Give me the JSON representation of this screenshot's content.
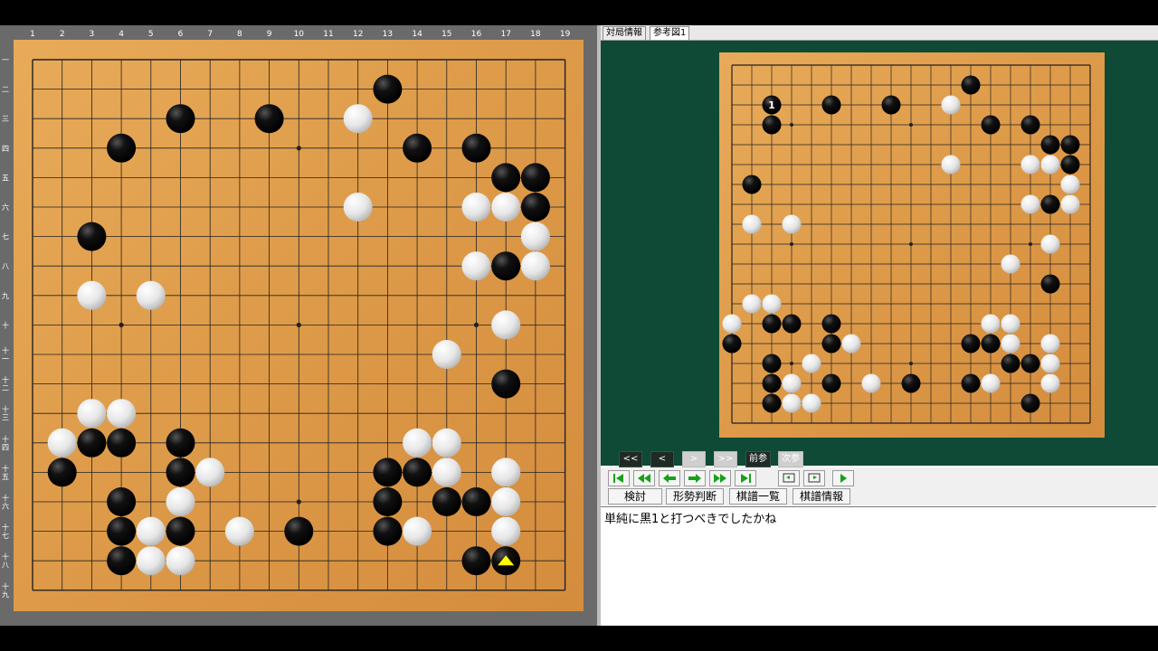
{
  "left_board": {
    "col_labels": [
      "1",
      "2",
      "3",
      "4",
      "5",
      "6",
      "7",
      "8",
      "9",
      "10",
      "11",
      "12",
      "13",
      "14",
      "15",
      "16",
      "17",
      "18",
      "19"
    ],
    "row_labels": [
      "一",
      "二",
      "三",
      "四",
      "五",
      "六",
      "七",
      "八",
      "九",
      "十",
      "十一",
      "十二",
      "十三",
      "十四",
      "十五",
      "十六",
      "十七",
      "十八",
      "十九"
    ],
    "black_stones": [
      [
        13,
        2
      ],
      [
        6,
        3
      ],
      [
        9,
        3
      ],
      [
        4,
        4
      ],
      [
        14,
        4
      ],
      [
        16,
        4
      ],
      [
        17,
        5
      ],
      [
        18,
        5
      ],
      [
        18,
        6
      ],
      [
        3,
        7
      ],
      [
        17,
        8
      ],
      [
        17,
        12
      ],
      [
        3,
        14
      ],
      [
        4,
        14
      ],
      [
        6,
        14
      ],
      [
        2,
        15
      ],
      [
        6,
        15
      ],
      [
        13,
        15
      ],
      [
        14,
        15
      ],
      [
        4,
        16
      ],
      [
        13,
        16
      ],
      [
        15,
        16
      ],
      [
        16,
        16
      ],
      [
        4,
        17
      ],
      [
        6,
        17
      ],
      [
        10,
        17
      ],
      [
        13,
        17
      ],
      [
        4,
        18
      ],
      [
        16,
        18
      ],
      [
        17,
        18
      ]
    ],
    "white_stones": [
      [
        12,
        3
      ],
      [
        12,
        6
      ],
      [
        16,
        6
      ],
      [
        17,
        6
      ],
      [
        18,
        7
      ],
      [
        16,
        8
      ],
      [
        18,
        8
      ],
      [
        3,
        9
      ],
      [
        5,
        9
      ],
      [
        17,
        10
      ],
      [
        15,
        11
      ],
      [
        3,
        13
      ],
      [
        4,
        13
      ],
      [
        2,
        14
      ],
      [
        14,
        14
      ],
      [
        15,
        14
      ],
      [
        7,
        15
      ],
      [
        15,
        15
      ],
      [
        17,
        15
      ],
      [
        6,
        16
      ],
      [
        17,
        16
      ],
      [
        5,
        17
      ],
      [
        8,
        17
      ],
      [
        14,
        17
      ],
      [
        17,
        17
      ],
      [
        5,
        18
      ],
      [
        6,
        18
      ]
    ],
    "last_move": [
      17,
      18
    ],
    "star_points": [
      [
        4,
        4
      ],
      [
        10,
        4
      ],
      [
        16,
        4
      ],
      [
        4,
        10
      ],
      [
        10,
        10
      ],
      [
        16,
        10
      ],
      [
        4,
        16
      ],
      [
        10,
        16
      ],
      [
        16,
        16
      ]
    ]
  },
  "right_board": {
    "black_stones": [
      [
        13,
        2
      ],
      [
        3,
        3
      ],
      [
        6,
        3
      ],
      [
        9,
        3
      ],
      [
        3,
        4
      ],
      [
        14,
        4
      ],
      [
        16,
        4
      ],
      [
        17,
        5
      ],
      [
        18,
        5
      ],
      [
        18,
        6
      ],
      [
        2,
        7
      ],
      [
        17,
        8
      ],
      [
        17,
        12
      ],
      [
        3,
        14
      ],
      [
        4,
        14
      ],
      [
        6,
        14
      ],
      [
        1,
        15
      ],
      [
        6,
        15
      ],
      [
        13,
        15
      ],
      [
        14,
        15
      ],
      [
        3,
        16
      ],
      [
        15,
        16
      ],
      [
        16,
        16
      ],
      [
        3,
        17
      ],
      [
        6,
        17
      ],
      [
        10,
        17
      ],
      [
        13,
        17
      ],
      [
        3,
        18
      ],
      [
        16,
        18
      ]
    ],
    "white_stones": [
      [
        12,
        3
      ],
      [
        12,
        6
      ],
      [
        16,
        6
      ],
      [
        17,
        6
      ],
      [
        18,
        7
      ],
      [
        16,
        8
      ],
      [
        18,
        8
      ],
      [
        2,
        9
      ],
      [
        4,
        9
      ],
      [
        17,
        10
      ],
      [
        15,
        11
      ],
      [
        2,
        13
      ],
      [
        3,
        13
      ],
      [
        1,
        14
      ],
      [
        14,
        14
      ],
      [
        15,
        14
      ],
      [
        7,
        15
      ],
      [
        15,
        15
      ],
      [
        17,
        15
      ],
      [
        5,
        16
      ],
      [
        17,
        16
      ],
      [
        4,
        17
      ],
      [
        8,
        17
      ],
      [
        14,
        17
      ],
      [
        17,
        17
      ],
      [
        4,
        18
      ],
      [
        5,
        18
      ]
    ],
    "numbered_stone": {
      "col": 3,
      "row": 3,
      "label": "1"
    },
    "star_points": [
      [
        4,
        4
      ],
      [
        10,
        4
      ],
      [
        16,
        4
      ],
      [
        4,
        10
      ],
      [
        10,
        10
      ],
      [
        16,
        10
      ],
      [
        4,
        16
      ],
      [
        10,
        16
      ],
      [
        16,
        16
      ]
    ]
  },
  "tabs": [
    {
      "label": "対局情報"
    },
    {
      "label": "参考図1"
    }
  ],
  "review_nav": {
    "first": "<<",
    "prev": "<",
    "next": ">",
    "last": ">>",
    "prev_ref": "前参",
    "next_ref": "次参"
  },
  "nav_buttons": [
    "first-move",
    "back-10",
    "back-1",
    "forward-1",
    "forward-10",
    "last-move",
    "comment-prev",
    "comment-next",
    "play"
  ],
  "commands": {
    "review": "検討",
    "position_judgment": "形勢判断",
    "kifu_list": "棋譜一覧",
    "kifu_info": "棋譜情報"
  },
  "comment": "単純に黒1と打つべきでしたかね",
  "colors": {
    "board": "#e0a04e",
    "panel_green": "#0e4a35",
    "nav_green": "#18a018",
    "last_move_marker": "#ffff00"
  }
}
